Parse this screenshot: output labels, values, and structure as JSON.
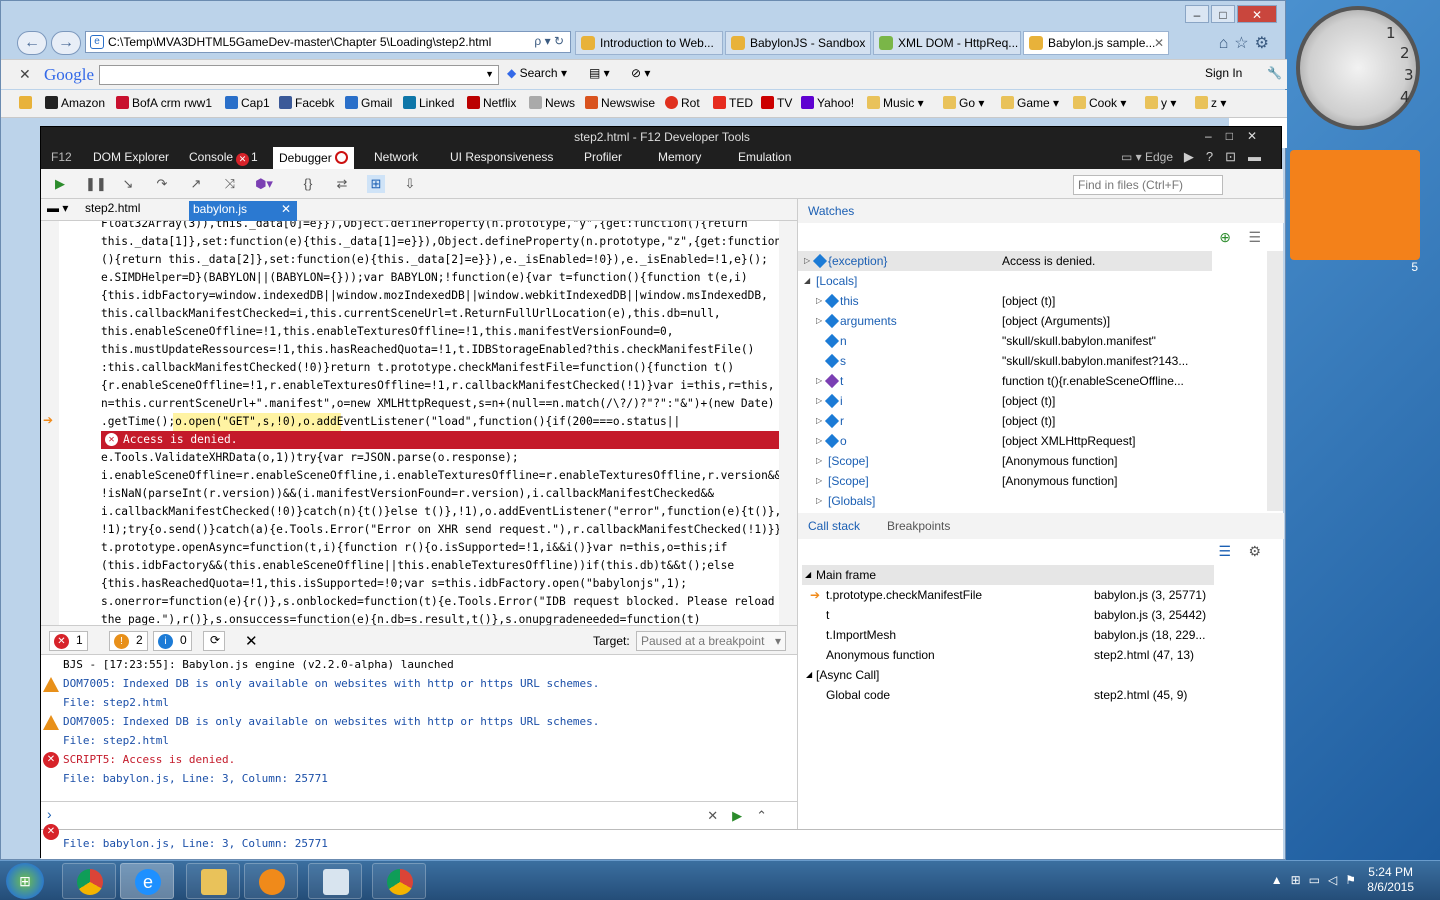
{
  "desktop": {
    "clock_numbers": [
      "1",
      "2",
      "3",
      "4"
    ],
    "calendar_digit": "5"
  },
  "window": {
    "controls": [
      "–",
      "□",
      "✕"
    ]
  },
  "address_bar": {
    "url": "C:\\Temp\\MVA3DHTML5GameDev-master\\Chapter 5\\Loading\\step2.html",
    "controls": "ρ ▾ ↻"
  },
  "tabs": [
    {
      "label": "Introduction to Web..."
    },
    {
      "label": "BabylonJS - Sandbox"
    },
    {
      "label": "XML DOM - HttpReq..."
    },
    {
      "label": "Babylon.js sample..."
    }
  ],
  "google_toolbar": {
    "logo": "Google",
    "search_label": "Search",
    "sign_in": "Sign In"
  },
  "favorites": [
    {
      "label": "Amazon"
    },
    {
      "label": "BofA crm rww1"
    },
    {
      "label": "Cap1"
    },
    {
      "label": "Facebk"
    },
    {
      "label": "Gmail"
    },
    {
      "label": "Linked"
    },
    {
      "label": "Netflix"
    },
    {
      "label": "News"
    },
    {
      "label": "Newswise"
    },
    {
      "label": "Rot"
    },
    {
      "label": "TED"
    },
    {
      "label": "TV"
    },
    {
      "label": "Yahoo!"
    },
    {
      "label": "Music ▾"
    },
    {
      "label": "Go ▾"
    },
    {
      "label": "Game ▾"
    },
    {
      "label": "Cook ▾"
    },
    {
      "label": "y ▾"
    },
    {
      "label": "z ▾"
    }
  ],
  "devtools": {
    "title": "step2.html - F12 Developer Tools",
    "tabs": [
      "F12",
      "DOM Explorer",
      "Console",
      "Debugger",
      "Network",
      "UI Responsiveness",
      "Profiler",
      "Memory",
      "Emulation"
    ],
    "console_error_count": "1",
    "edge_label": "Edge",
    "find_placeholder": "Find in files (Ctrl+F)",
    "file_tabs": [
      "step2.html",
      "babylon.js"
    ]
  },
  "code_lines": [
    "Float32Array(3)),this._data[0]=e}}),Object.defineProperty(n.prototype,\"y\",{get:function(){return",
    "this._data[1]},set:function(e){this._data[1]=e}}),Object.defineProperty(n.prototype,\"z\",{get:function",
    "(){return this._data[2]},set:function(e){this._data[2]=e}}),e._isEnabled=!0}),e._isEnabled=!1,e}();",
    "e.SIMDHelper=D}(BABYLON||(BABYLON={}));var BABYLON;!function(e){var t=function(){function t(e,i)",
    "{this.idbFactory=window.indexedDB||window.mozIndexedDB||window.webkitIndexedDB||window.msIndexedDB,",
    "this.callbackManifestChecked=i,this.currentSceneUrl=t.ReturnFullUrlLocation(e),this.db=null,",
    "this.enableSceneOffline=!1,this.enableTexturesOffline=!1,this.manifestVersionFound=0,",
    "this.mustUpdateRessources=!1,this.hasReachedQuota=!1,t.IDBStorageEnabled?this.checkManifestFile()",
    ":this.callbackManifestChecked(!0)}return t.prototype.checkManifestFile=function(){function t()",
    "{r.enableSceneOffline=!1,r.enableTexturesOffline=!1,r.callbackManifestChecked(!1)}var i=this,r=this,",
    "n=this.currentSceneUrl+\".manifest\",o=new XMLHttpRequest,s=n+(null==n.match(/\\?/)?\"?\":\"&\")+(new Date)",
    ".getTime();o.open(\"GET\",s,!0),o.addEventListener(\"load\",function(){if(200===o.status||"
  ],
  "code_error": "Access is denied.",
  "code_lines_after": [
    "e.Tools.ValidateXHRData(o,1))try{var r=JSON.parse(o.response);",
    "i.enableSceneOffline=r.enableSceneOffline,i.enableTexturesOffline=r.enableTexturesOffline,r.version&&",
    "!isNaN(parseInt(r.version))&&(i.manifestVersionFound=r.version),i.callbackManifestChecked&&",
    "i.callbackManifestChecked(!0)}catch(n){t()}else t()},!1),o.addEventListener(\"error\",function(e){t()},",
    "!1);try{o.send()}catch(a){e.Tools.Error(\"Error on XHR send request.\"),r.callbackManifestChecked(!1)}},",
    "t.prototype.openAsync=function(t,i){function r(){o.isSupported=!1,i&&i()}var n=this,o=this;if",
    "(this.idbFactory&&(this.enableSceneOffline||this.enableTexturesOffline))if(this.db)t&&t();else",
    "{this.hasReachedQuota=!1,this.isSupported=!0;var s=this.idbFactory.open(\"babylonjs\",1);",
    "s.onerror=function(e){r()},s.onblocked=function(t){e.Tools.Error(\"IDB request blocked. Please reload",
    "the page.\"),r()},s.onsuccess=function(e){n.db=s.result,t()},s.onupgradeneeded=function(t)"
  ],
  "console": {
    "filters": [
      {
        "count": "1",
        "icon": "✕"
      },
      {
        "count": "2",
        "icon": "!"
      },
      {
        "count": "0",
        "icon": "i"
      }
    ],
    "target_label": "Target:",
    "target_value": "Paused at a breakpoint",
    "messages": [
      {
        "type": "log",
        "text": "BJS - [17:23:55]: Babylon.js engine (v2.2.0-alpha) launched"
      },
      {
        "type": "warn",
        "text": "DOM7005: Indexed DB is only available on websites with http or https URL schemes."
      },
      {
        "type": "link",
        "text": "File: step2.html"
      },
      {
        "type": "warn",
        "text": "DOM7005: Indexed DB is only available on websites with http or https URL schemes."
      },
      {
        "type": "link",
        "text": "File: step2.html"
      },
      {
        "type": "err",
        "text": "SCRIPT5: Access is denied."
      },
      {
        "type": "link",
        "text": "File: babylon.js, Line: 3, Column: 25771"
      }
    ],
    "bottom_text": "File: babylon.js, Line: 3, Column: 25771"
  },
  "watches": {
    "title": "Watches",
    "rows": [
      {
        "name": "{exception}",
        "value": "Access is denied.",
        "selected": true
      },
      {
        "name": "[Locals]",
        "value": ""
      },
      {
        "name": "this",
        "value": "[object (t)]"
      },
      {
        "name": "arguments",
        "value": "[object (Arguments)]"
      },
      {
        "name": "n",
        "value": "\"skull/skull.babylon.manifest\""
      },
      {
        "name": "s",
        "value": "\"skull/skull.babylon.manifest?143..."
      },
      {
        "name": "t",
        "value": "function t(){r.enableSceneOffline..."
      },
      {
        "name": "i",
        "value": "[object (t)]"
      },
      {
        "name": "r",
        "value": "[object (t)]"
      },
      {
        "name": "o",
        "value": "[object XMLHttpRequest]"
      },
      {
        "name": "[Scope]",
        "value": "[Anonymous function]"
      },
      {
        "name": "[Scope]",
        "value": "[Anonymous function]"
      },
      {
        "name": "[Globals]",
        "value": ""
      }
    ]
  },
  "callstack": {
    "tabs": [
      "Call stack",
      "Breakpoints"
    ],
    "main_frame": "Main frame",
    "async_call": "[Async Call]",
    "frames": [
      {
        "fn": "t.prototype.checkManifestFile",
        "loc": "babylon.js (3, 25771)"
      },
      {
        "fn": "t",
        "loc": "babylon.js (3, 25442)"
      },
      {
        "fn": "t.ImportMesh",
        "loc": "babylon.js (18, 229..."
      },
      {
        "fn": "Anonymous function",
        "loc": "step2.html (47, 13)"
      }
    ],
    "global": {
      "fn": "Global code",
      "loc": "step2.html (45, 9)"
    }
  },
  "taskbar": {
    "time": "5:24 PM",
    "date": "8/6/2015"
  },
  "colors": {
    "error_red": "#c41a2a",
    "link_blue": "#1b5fb3",
    "warn_orange": "#e8901a"
  }
}
